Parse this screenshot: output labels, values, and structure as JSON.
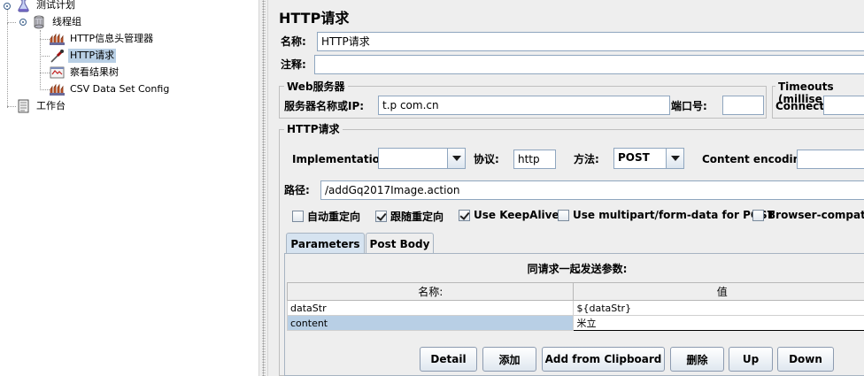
{
  "tree": {
    "test_plan": "测试计划",
    "thread_group": "线程组",
    "header_manager": "HTTP信息头管理器",
    "http_request": "HTTP请求",
    "results_tree": "察看结果树",
    "csv_config": "CSV Data Set Config",
    "workbench": "工作台"
  },
  "panel": {
    "title": "HTTP请求",
    "name_label": "名称:",
    "name_value": "HTTP请求",
    "comment_label": "注释:",
    "comment_value": ""
  },
  "web_server": {
    "legend": "Web服务器",
    "server_label": "服务器名称或IP:",
    "server_value": "t.p         com.cn",
    "port_label": "端口号:",
    "port_value": ""
  },
  "timeouts": {
    "legend": "Timeouts (millise",
    "connect_label": "Connect:",
    "connect_value": ""
  },
  "http_request": {
    "legend": "HTTP请求",
    "implementation_label": "Implementation:",
    "implementation_value": "",
    "protocol_label": "协议:",
    "protocol_value": "http",
    "method_label": "方法:",
    "method_value": "POST",
    "encoding_label": "Content encoding:",
    "encoding_value": "",
    "path_label": "路径:",
    "path_value": "/addGq2017Image.action"
  },
  "options": {
    "auto_redirect": "自动重定向",
    "follow_redirect": "跟随重定向",
    "keepalive": "Use KeepAlive",
    "multipart": "Use multipart/form-data for POST",
    "browser_compat": "Browser-compatibl",
    "auto_redirect_checked": false,
    "follow_redirect_checked": true,
    "keepalive_checked": true,
    "multipart_checked": false,
    "browser_compat_checked": false
  },
  "tabs": {
    "parameters": "Parameters",
    "post_body": "Post Body"
  },
  "params": {
    "caption": "同请求一起发送参数:",
    "col_name": "名称:",
    "col_value": "值",
    "rows": [
      {
        "name": "dataStr",
        "value": "${dataStr}"
      },
      {
        "name": "content",
        "value": "米立"
      }
    ]
  },
  "buttons": {
    "detail": "Detail",
    "add": "添加",
    "add_clipboard": "Add from Clipboard",
    "delete": "删除",
    "up": "Up",
    "down": "Down"
  },
  "colors": {
    "selection": "#b8cfe5",
    "panel_bg": "#eeeeee",
    "field_border": "#8fa6bf"
  }
}
